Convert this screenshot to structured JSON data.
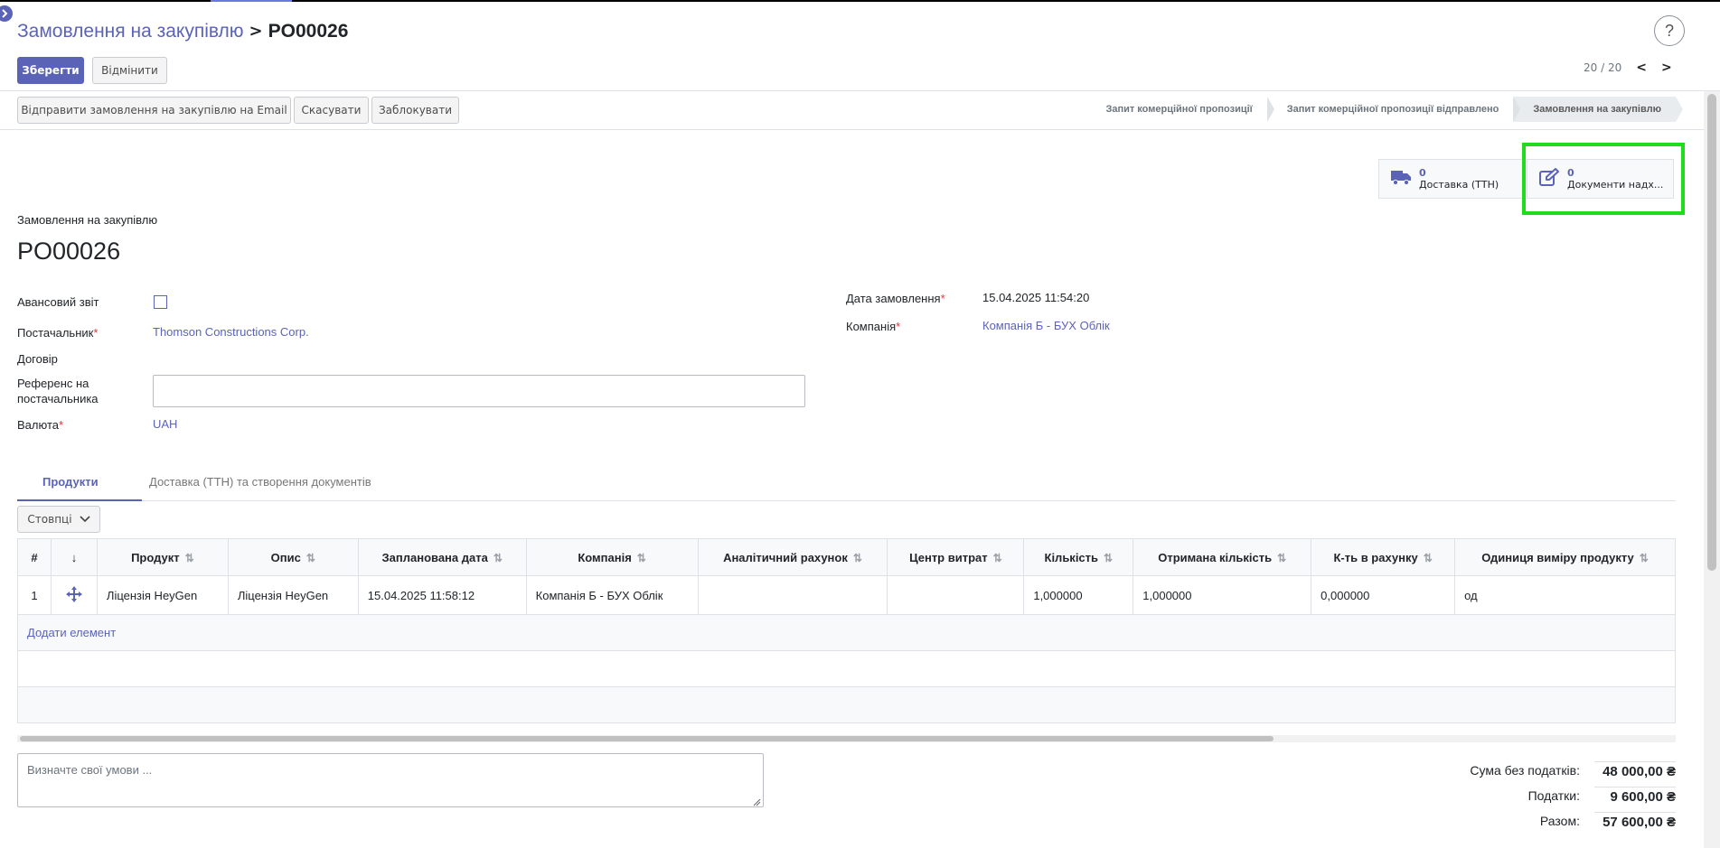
{
  "breadcrumb": {
    "parent": "Замовлення на закупівлю",
    "separator": ">",
    "current": "PO00026"
  },
  "help": {
    "label": "?"
  },
  "toolbar": {
    "save_label": "Зберегти",
    "discard_label": "Відмінити"
  },
  "pager": {
    "value": "20 / 20",
    "prev": "<",
    "next": ">"
  },
  "header_buttons": {
    "send_email": "Відправити замовлення на закупівлю на Email",
    "cancel": "Скасувати",
    "lock": "Заблокувати"
  },
  "status_steps": [
    {
      "label": "Запит комерційної пропозиції",
      "active": false
    },
    {
      "label": "Запит комерційної пропозиції відправлено",
      "active": false
    },
    {
      "label": "Замовлення на закупівлю",
      "active": true
    }
  ],
  "smart_buttons": [
    {
      "count": "0",
      "label": "Доставка (ТТН)",
      "icon": "truck-icon"
    },
    {
      "count": "0",
      "label": "Документи надх...",
      "icon": "pencil-square-icon"
    }
  ],
  "form": {
    "doc_type": "Замовлення на закупівлю",
    "doc_name": "PO00026",
    "advance_report_label": "Авансовий звіт",
    "vendor_label": "Постачальник",
    "vendor_value": "Thomson Constructions Corp.",
    "contract_label": "Договір",
    "vendor_ref_label_1": "Референс на",
    "vendor_ref_label_2": "постачальника",
    "currency_label": "Валюта",
    "currency_value": "UAH",
    "order_date_label": "Дата замовлення",
    "order_date_value": "15.04.2025 11:54:20",
    "company_label": "Компанія",
    "company_value": "Компанія Б - БУХ Облік",
    "required_mark": "*"
  },
  "tabs": [
    {
      "label": "Продукти",
      "active": true
    },
    {
      "label": "Доставка (ТТН) та створення документів",
      "active": false
    }
  ],
  "columns_button": "Стовпці",
  "table": {
    "headers": [
      "#",
      "↓",
      "Продукт",
      "Опис",
      "Запланована дата",
      "Компанія",
      "Аналітичний рахунок",
      "Центр витрат",
      "Кількість",
      "Отримана кількість",
      "К-ть в рахунку",
      "Одиниця виміру продукту"
    ],
    "row": {
      "num": "1",
      "product": "Ліцензія HeyGen",
      "description": "Ліцензія HeyGen",
      "planned_date": "15.04.2025 11:58:12",
      "company": "Компанія Б - БУХ Облік",
      "analytic": "",
      "cost_center": "",
      "qty": "1,000000",
      "received_qty": "1,000000",
      "invoiced_qty": "0,000000",
      "uom": "од"
    },
    "add_line": "Додати елемент"
  },
  "notes_placeholder": "Визначте свої умови ...",
  "totals": {
    "untaxed_label": "Сума без податків:",
    "untaxed_value": "48 000,00 ₴",
    "taxes_label": "Податки:",
    "taxes_value": "9 600,00 ₴",
    "total_label": "Разом:",
    "total_value": "57 600,00 ₴"
  },
  "colors": {
    "primary": "#5b63b7",
    "highlight": "#1fdc1f",
    "required": "#e0353a"
  }
}
